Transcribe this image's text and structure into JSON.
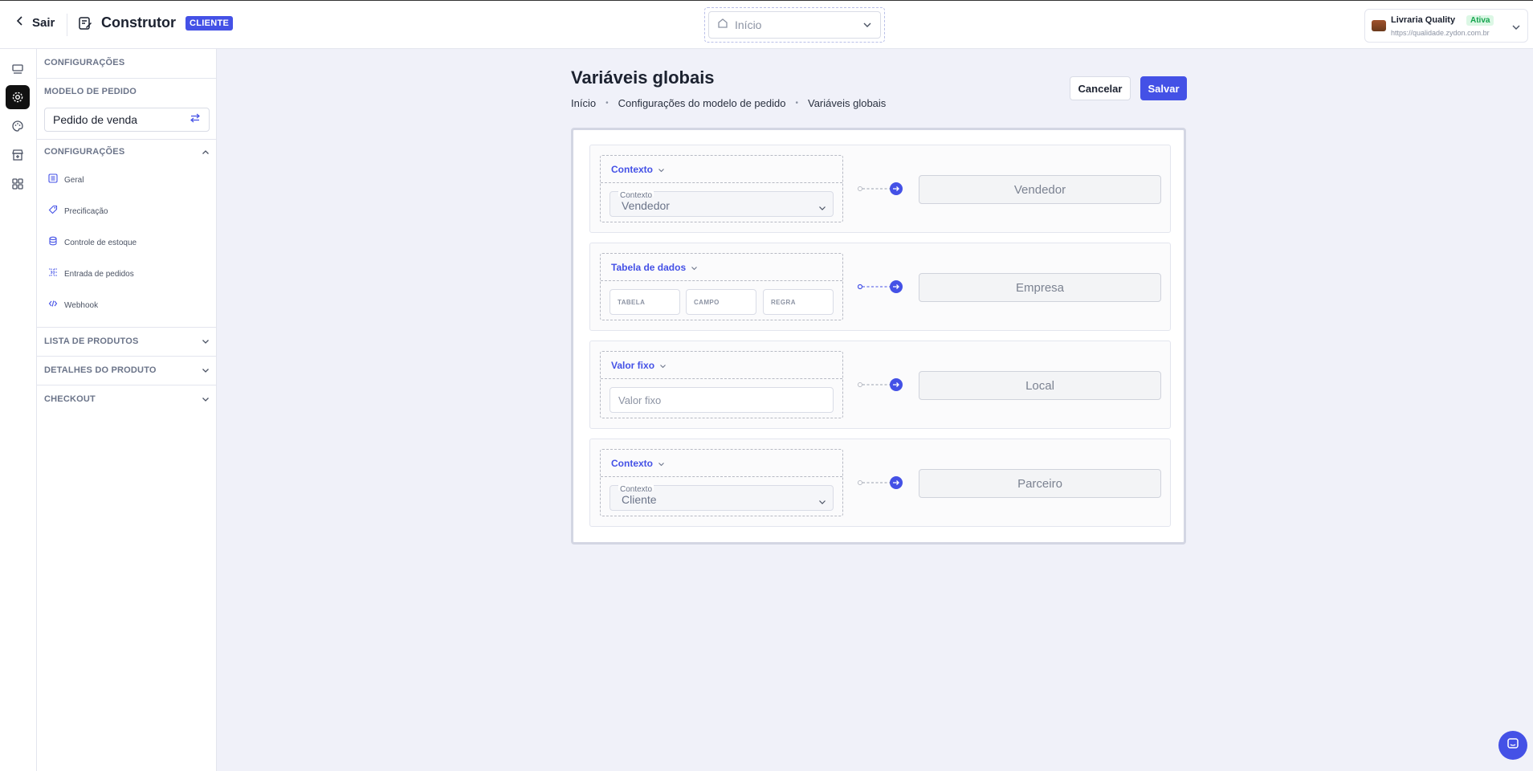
{
  "topbar": {
    "back_label": "Sair",
    "title": "Construtor",
    "badge": "CLIENTE",
    "page_select": "Início",
    "account": {
      "name": "Livraria Quality",
      "status": "Ativa",
      "url": "https://qualidade.zydon.com.br"
    }
  },
  "rail": {
    "icons": [
      "layout-icon",
      "gear-icon",
      "palette-icon",
      "storefront-icon",
      "apps-grid-icon"
    ],
    "active": "gear-icon"
  },
  "sidebar": {
    "header": "CONFIGURAÇÕES",
    "model_label": "MODELO DE PEDIDO",
    "model_value": "Pedido de venda",
    "groups": [
      {
        "title": "CONFIGURAÇÕES",
        "expanded": true,
        "items": [
          {
            "label": "Geral",
            "icon": "list-icon"
          },
          {
            "label": "Precificação",
            "icon": "tag-icon"
          },
          {
            "label": "Controle de estoque",
            "icon": "database-icon"
          },
          {
            "label": "Entrada de pedidos",
            "icon": "flow-icon"
          },
          {
            "label": "Webhook",
            "icon": "code-icon"
          }
        ]
      },
      {
        "title": "LISTA DE PRODUTOS",
        "expanded": false
      },
      {
        "title": "DETALHES DO PRODUTO",
        "expanded": false
      },
      {
        "title": "CHECKOUT",
        "expanded": false
      }
    ]
  },
  "main": {
    "title": "Variáveis globais",
    "breadcrumb": [
      "Início",
      "Configurações do modelo de pedido",
      "Variáveis globais"
    ],
    "cancel_label": "Cancelar",
    "save_label": "Salvar",
    "rows": [
      {
        "type_label": "Contexto",
        "field_label": "Contexto",
        "value": "Vendedor",
        "target": "Vendedor"
      },
      {
        "type_label": "Tabela de dados",
        "fields": [
          "TABELA",
          "CAMPO",
          "REGRA"
        ],
        "target": "Empresa"
      },
      {
        "type_label": "Valor fixo",
        "placeholder": "Valor fixo",
        "target": "Local"
      },
      {
        "type_label": "Contexto",
        "field_label": "Contexto",
        "value": "Cliente",
        "target": "Parceiro"
      }
    ]
  },
  "colors": {
    "accent": "#4451e6",
    "active_status": "#14a44d"
  }
}
